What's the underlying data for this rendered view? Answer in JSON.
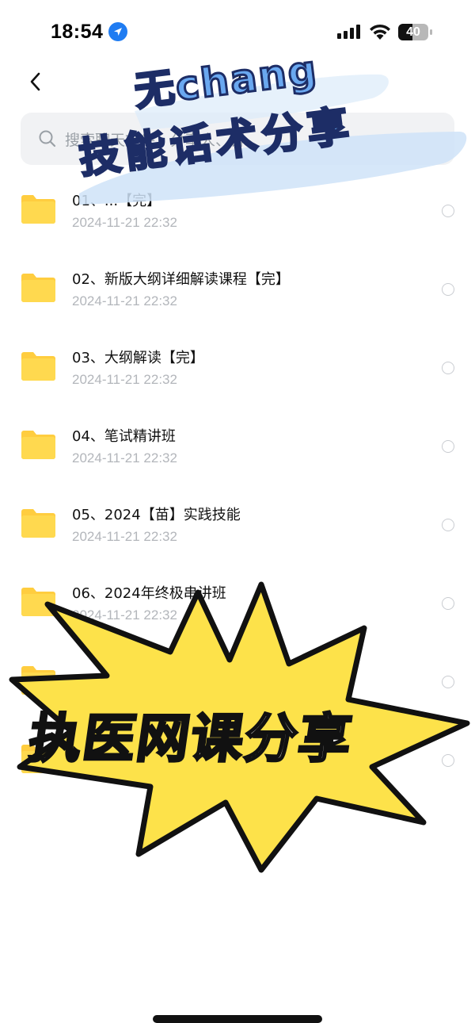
{
  "status_bar": {
    "time": "18:54",
    "battery": "40"
  },
  "header": {
    "title": "?",
    "back_icon": "chevron-left-icon"
  },
  "search": {
    "placeholder": "搜索聊天文件、分享人、群"
  },
  "files": [
    {
      "name": "01、...【完】",
      "date": "2024-11-21 22:32"
    },
    {
      "name": "02、新版大纲详细解读课程【完】",
      "date": "2024-11-21 22:32"
    },
    {
      "name": "03、大纲解读【完】",
      "date": "2024-11-21 22:32"
    },
    {
      "name": "04、笔试精讲班",
      "date": "2024-11-21 22:32"
    },
    {
      "name": "05、2024【苗】实践技能",
      "date": "2024-11-21 22:32"
    },
    {
      "name": "06、2024年终极串讲班",
      "date": "2024-11-21 22:32"
    },
    {
      "name": "",
      "date": ""
    },
    {
      "name": "",
      "date": ""
    }
  ],
  "overlay": {
    "brand_line1": "无chang",
    "brand_line2": "技能话术分享",
    "burst_text": "执医网课分享"
  },
  "colors": {
    "folder": "#ffcd3f",
    "accent_blue": "#1f7cf2",
    "burst_yellow": "#fde24a",
    "brand_blue": "#6aa8f0"
  }
}
